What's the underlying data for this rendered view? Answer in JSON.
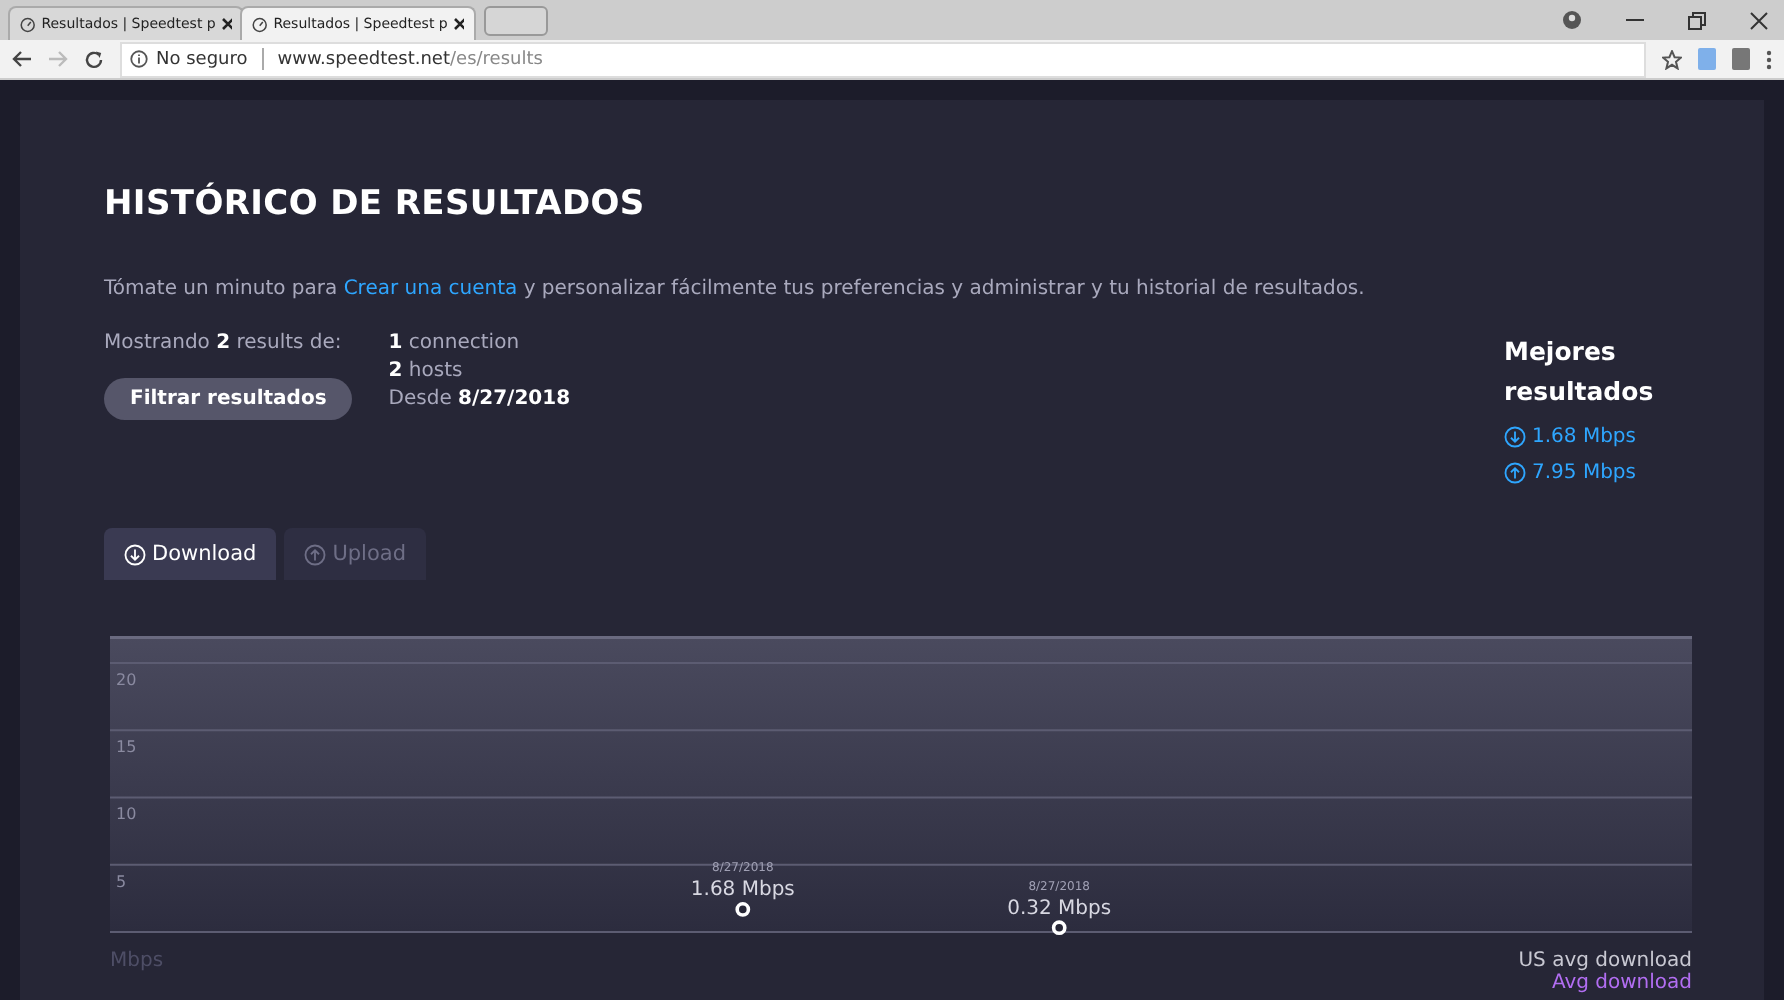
{
  "browser": {
    "tabs": [
      {
        "title": "Resultados | Speedtest p",
        "selected": false
      },
      {
        "title": "Resultados | Speedtest p",
        "selected": true
      }
    ],
    "toolbar": {
      "security": "No seguro",
      "url_host": "www.speedtest.net",
      "url_path": "/es/results",
      "forward_disabled": true
    }
  },
  "page": {
    "title": "HISTÓRICO DE RESULTADOS",
    "intro": {
      "before": "Tómate un minuto para",
      "link": "Crear una cuenta",
      "after": "y personalizar fácilmente tus preferencias y administrar y tu historial de resultados."
    },
    "summary": {
      "showing": "Mostrando **2** results de:",
      "connections": "**1** connection",
      "hosts": "**2** hosts",
      "since": "Desde **8/27/2018**"
    },
    "filter_button": "Filtrar resultados",
    "best": {
      "title": "Mejores resultados",
      "results": [
        {
          "kind": "download",
          "value": "1.68 Mbps"
        },
        {
          "kind": "upload",
          "value": "7.95 Mbps"
        }
      ]
    },
    "tabs": [
      {
        "label": "Download",
        "kind": "download",
        "selected": true
      },
      {
        "label": "Upload",
        "kind": "upload",
        "selected": false
      }
    ],
    "chart": {
      "unit": "Mbps",
      "legend": [
        {
          "label": "US avg download",
          "color": "#c8c8d2"
        },
        {
          "label": "Avg download",
          "color": "#b26ef2"
        }
      ],
      "chart_data": {
        "type": "scatter",
        "grid": true,
        "ylim": [
          0,
          22
        ],
        "yticks": [
          5,
          10,
          15,
          20
        ],
        "categories": [
          "8/27/2018",
          "8/27/2018"
        ],
        "series": [
          {
            "color": "#ffffff",
            "values": [
              1.68,
              0.32
            ]
          }
        ],
        "value_labels": [
          "1.68 Mbps",
          "0.32 Mbps"
        ]
      }
    }
  }
}
